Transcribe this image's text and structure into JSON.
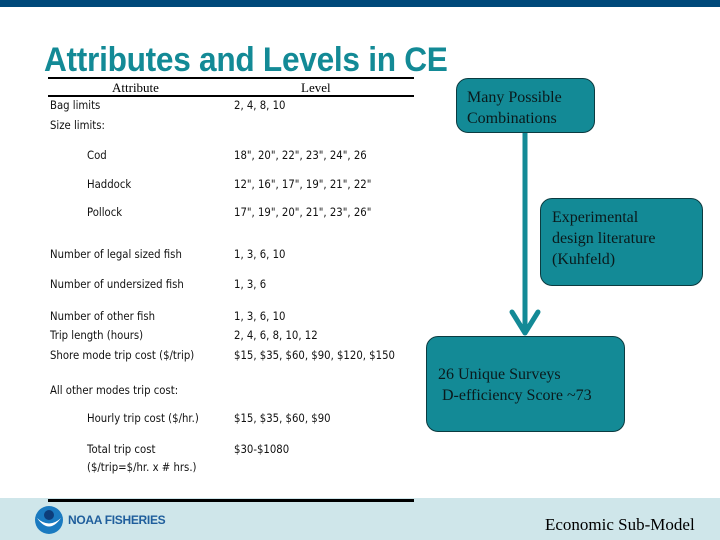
{
  "slide": {
    "title": "Attributes and Levels in CE",
    "table": {
      "headers": {
        "attribute": "Attribute",
        "level": "Level"
      },
      "rows": [
        {
          "attribute": "Bag limits",
          "level": "2, 4, 8, 10"
        },
        {
          "attribute": "Size limits:",
          "level": ""
        },
        {
          "attribute": "Cod",
          "level": "18\", 20\", 22\", 23\", 24\", 26"
        },
        {
          "attribute": "Haddock",
          "level": "12\", 16\", 17\", 19\", 21\", 22\""
        },
        {
          "attribute": "Pollock",
          "level": "17\", 19\", 20\", 21\", 23\", 26\""
        },
        {
          "attribute": "Number of legal sized fish",
          "level": "1, 3, 6, 10"
        },
        {
          "attribute": "Number of undersized fish",
          "level": "1, 3, 6"
        },
        {
          "attribute": "Number of other fish",
          "level": "1, 3, 6, 10"
        },
        {
          "attribute": "Trip length (hours)",
          "level": "2, 4, 6, 8, 10, 12"
        },
        {
          "attribute": "Shore mode trip cost ($/trip)",
          "level": "$15, $35, $60, $90, $120, $150"
        },
        {
          "attribute": "All other modes trip cost:",
          "level": ""
        },
        {
          "attribute": "Hourly trip cost ($/hr.)",
          "level": "$15, $35, $60, $90"
        },
        {
          "attribute": "Total trip cost",
          "level": "$30-$1080"
        },
        {
          "attribute": "($/trip=$/hr. x # hrs.)",
          "level": ""
        }
      ]
    },
    "boxes": {
      "combinations": [
        "Many Possible",
        "Combinations"
      ],
      "literature": [
        "Experimental",
        "design literature",
        "(Kuhfeld)"
      ],
      "result": [
        "26 Unique Surveys",
        "D-efficiency Score ~73"
      ]
    },
    "footer": {
      "logo_text": "NOAA FISHERIES",
      "logo_icon": "noaa-logo-icon",
      "section": "Economic Sub-Model"
    },
    "colors": {
      "top_bar": "#00497a",
      "title": "#138a96",
      "box_fill": "#138a96",
      "footer_band": "#cfe6ea"
    }
  }
}
